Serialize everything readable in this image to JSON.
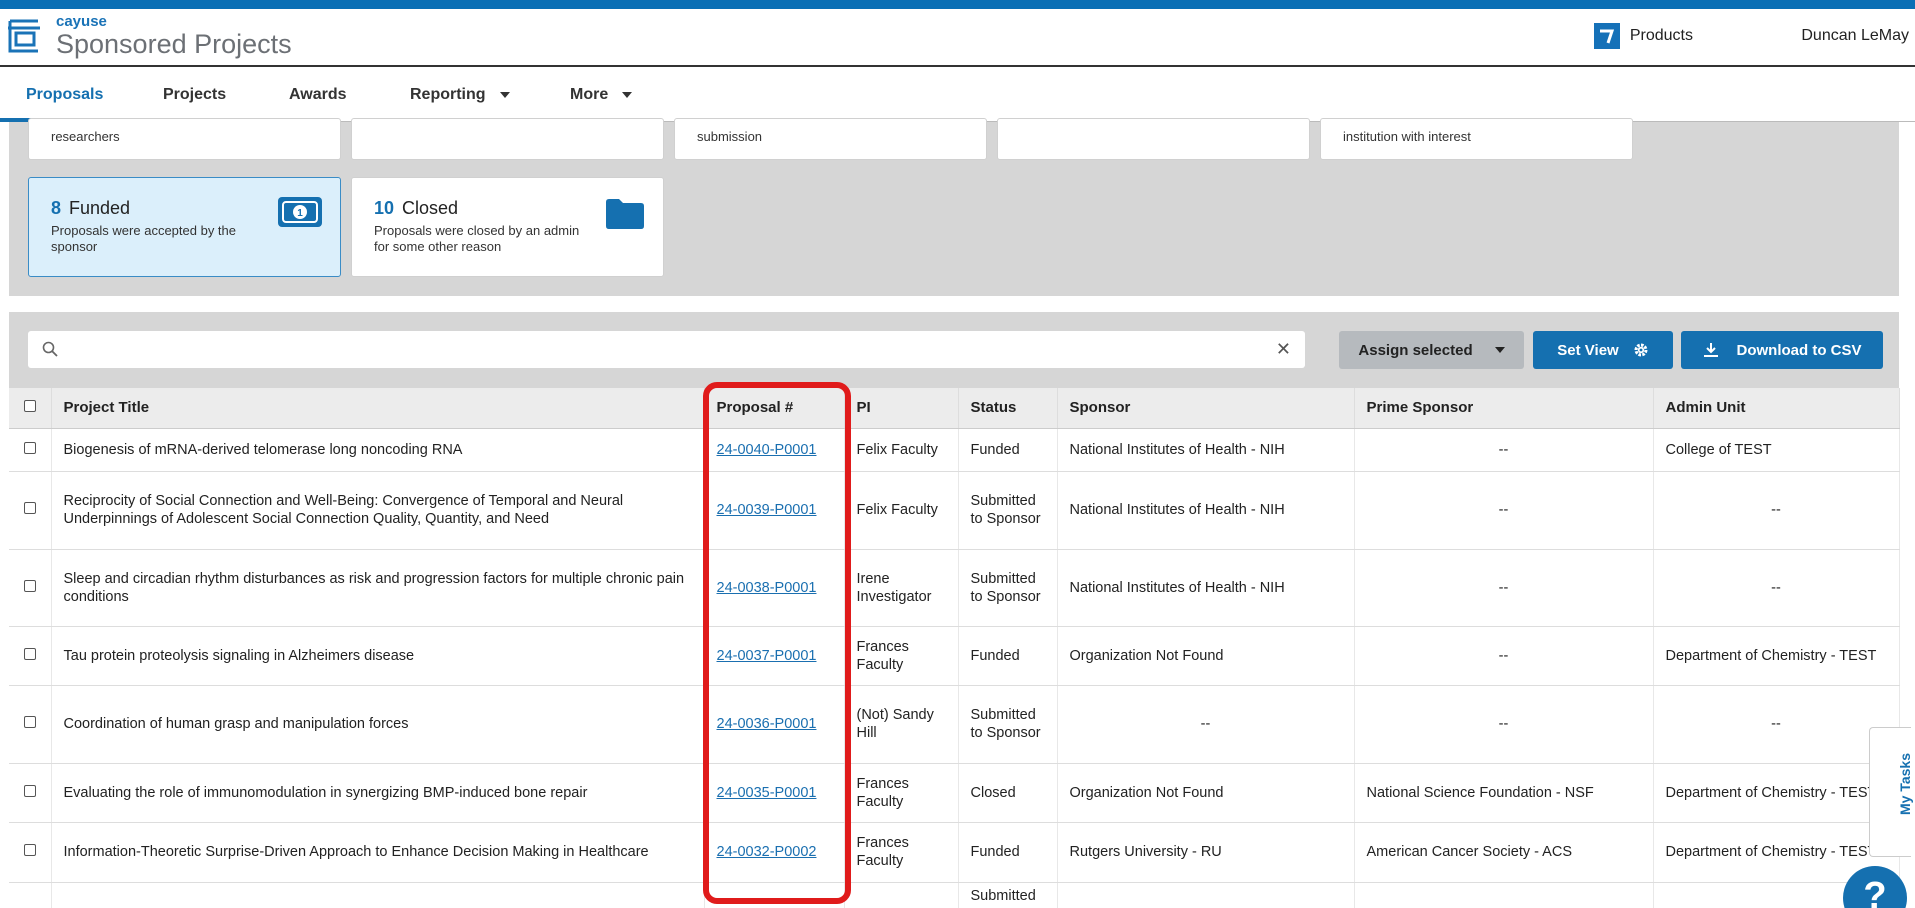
{
  "app": {
    "logo_small": "cayuse",
    "logo_big": "Sponsored Projects",
    "products_label": "Products",
    "user_name": "Duncan LeMay",
    "accent_color": "#1570b0"
  },
  "nav": {
    "items": [
      {
        "label": "Proposals",
        "active": true
      },
      {
        "label": "Projects"
      },
      {
        "label": "Awards"
      },
      {
        "label": "Reporting",
        "dropdown": true
      },
      {
        "label": "More",
        "dropdown": true
      }
    ]
  },
  "cards_top": [
    {
      "desc_line1": "researchers"
    },
    {
      "desc_line1": ""
    },
    {
      "desc_line1": "submission"
    },
    {
      "desc_line1": ""
    },
    {
      "desc_line1": "institution with interest"
    }
  ],
  "cards": [
    {
      "count": "8",
      "title": "Funded",
      "desc": "Proposals were accepted by the sponsor",
      "icon": "money-icon"
    },
    {
      "count": "10",
      "title": "Closed",
      "desc": "Proposals were closed by an admin for some other reason",
      "icon": "folder-icon"
    }
  ],
  "toolbar": {
    "search_placeholder": "",
    "assign_label": "Assign selected",
    "set_view_label": "Set View",
    "download_label": "Download to CSV"
  },
  "table": {
    "headers": [
      "Project Title",
      "Proposal #",
      "PI",
      "Status",
      "Sponsor",
      "Prime Sponsor",
      "Admin Unit"
    ],
    "rows": [
      {
        "title": "Biogenesis of mRNA-derived telomerase long noncoding RNA",
        "proposal": "24-0040-P0001",
        "pi": "Felix Faculty",
        "status": "Funded",
        "sponsor": "National Institutes of Health - NIH",
        "prime": "--",
        "admin": "College of TEST"
      },
      {
        "title": "Reciprocity of Social Connection and Well-Being: Convergence of Temporal and Neural Underpinnings of Adolescent Social Connection Quality, Quantity, and Need",
        "proposal": "24-0039-P0001",
        "pi": "Felix Faculty",
        "status": "Submitted to Sponsor",
        "sponsor": "National Institutes of Health - NIH",
        "prime": "--",
        "admin": "--"
      },
      {
        "title": "Sleep and circadian rhythm disturbances as risk and progression factors for multiple chronic pain conditions",
        "proposal": "24-0038-P0001",
        "pi": "Irene Investigator",
        "status": "Submitted to Sponsor",
        "sponsor": "National Institutes of Health - NIH",
        "prime": "--",
        "admin": "--"
      },
      {
        "title": "Tau protein proteolysis signaling in Alzheimers disease",
        "proposal": "24-0037-P0001",
        "pi": "Frances Faculty",
        "status": "Funded",
        "sponsor": "Organization Not Found",
        "prime": "--",
        "admin": "Department of Chemistry - TEST"
      },
      {
        "title": "Coordination of human grasp and manipulation forces",
        "proposal": "24-0036-P0001",
        "pi": "(Not) Sandy Hill",
        "status": "Submitted to Sponsor",
        "sponsor": "--",
        "prime": "--",
        "admin": "--"
      },
      {
        "title": "Evaluating the role of immunomodulation in synergizing BMP-induced bone repair",
        "proposal": "24-0035-P0001",
        "pi": "Frances Faculty",
        "status": "Closed",
        "sponsor": "Organization Not Found",
        "prime": "National Science Foundation - NSF",
        "admin": "Department of Chemistry - TEST"
      },
      {
        "title": "Information-Theoretic Surprise-Driven Approach to Enhance Decision Making in Healthcare",
        "proposal": "24-0032-P0002",
        "pi": "Frances Faculty",
        "status": "Funded",
        "sponsor": "Rutgers University - RU",
        "prime": "American Cancer Society - ACS",
        "admin": "Department of Chemistry - TEST"
      },
      {
        "title": "",
        "proposal": "",
        "pi": "",
        "status": "Submitted",
        "sponsor": "",
        "prime": "",
        "admin": ""
      }
    ]
  },
  "side": {
    "my_tasks": "My Tasks",
    "help": "?"
  }
}
